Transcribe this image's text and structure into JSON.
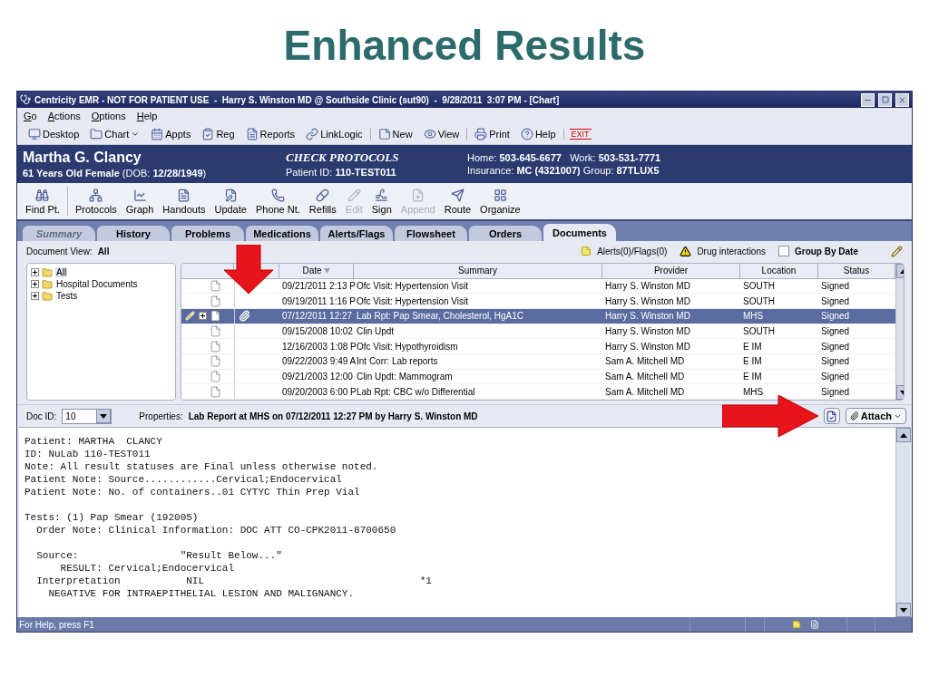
{
  "slide": {
    "title": "Enhanced Results"
  },
  "window": {
    "title": "Centricity EMR - NOT FOR PATIENT USE  -  Harry S. Winston MD @ Southside Clinic (sut90)  -  9/28/2011  3:07 PM - [Chart]"
  },
  "menu": [
    "Go",
    "Actions",
    "Options",
    "Help"
  ],
  "toolbar": [
    [
      {
        "label": "Desktop",
        "dropdown": false
      },
      {
        "label": "Chart",
        "dropdown": true
      },
      {
        "label": "Appts",
        "dropdown": false
      },
      {
        "label": "Reg",
        "dropdown": false
      },
      {
        "label": "Reports",
        "dropdown": false
      },
      {
        "label": "LinkLogic",
        "dropdown": false
      }
    ],
    [
      {
        "label": "New",
        "dropdown": false
      },
      {
        "label": "View",
        "dropdown": false
      }
    ],
    [
      {
        "label": "Print",
        "dropdown": false
      },
      {
        "label": "Help",
        "dropdown": false
      }
    ],
    [
      {
        "label": "EXIT",
        "dropdown": false,
        "kind": "exit"
      }
    ]
  ],
  "patient": {
    "name": "Martha G. Clancy",
    "details": "**61 Years Old Female** (DOB: **12/28/1949**)",
    "alert": "CHECK PROTOCOLS",
    "patient_id": "Patient ID: **110-TEST011**",
    "phones": "Home: **503-645-6677**   Work: **503-531-7771**",
    "insurance": "Insurance: **MC (4321007)** Group: **87TLUX5**"
  },
  "actions": [
    {
      "label": "Find Pt.",
      "disabled": false
    },
    {
      "label": "Protocols",
      "disabled": false
    },
    {
      "label": "Graph",
      "disabled": false
    },
    {
      "label": "Handouts",
      "disabled": false
    },
    {
      "label": "Update",
      "disabled": false
    },
    {
      "label": "Phone Nt.",
      "disabled": false
    },
    {
      "label": "Refills",
      "disabled": false
    },
    {
      "label": "Edit",
      "disabled": true
    },
    {
      "label": "Sign",
      "disabled": false
    },
    {
      "label": "Append",
      "disabled": true
    },
    {
      "label": "Route",
      "disabled": false
    },
    {
      "label": "Organize",
      "disabled": false
    }
  ],
  "tabs": [
    {
      "label": "Summary",
      "selected": false,
      "disabled": true
    },
    {
      "label": "History",
      "selected": false,
      "disabled": false
    },
    {
      "label": "Problems",
      "selected": false,
      "disabled": false
    },
    {
      "label": "Medications",
      "selected": false,
      "disabled": false
    },
    {
      "label": "Alerts/Flags",
      "selected": false,
      "disabled": false
    },
    {
      "label": "Flowsheet",
      "selected": false,
      "disabled": false
    },
    {
      "label": "Orders",
      "selected": false,
      "disabled": false
    },
    {
      "label": "Documents",
      "selected": true,
      "disabled": false
    }
  ],
  "document_view": {
    "label": "Document View:",
    "value": "All",
    "alerts": "Alerts(0)/Flags(0)",
    "drug_interactions": "Drug interactions",
    "group_by_date": {
      "label": "Group By Date",
      "checked": false
    }
  },
  "tree": [
    {
      "label": "All",
      "expanded": false,
      "selected": true
    },
    {
      "label": "Hospital Documents",
      "expanded": false,
      "selected": false
    },
    {
      "label": "Tests",
      "expanded": false,
      "selected": false
    }
  ],
  "table": {
    "columns": [
      "Date",
      "Summary",
      "Provider",
      "Location",
      "Status"
    ],
    "rows": [
      {
        "date": "09/21/2011 2:13 P",
        "summary": "Ofc Visit: Hypertension Visit",
        "provider": "Harry S. Winston MD",
        "location": "SOUTH",
        "status": "Signed",
        "selected": false,
        "edited": false,
        "expandable": false,
        "attachment": false
      },
      {
        "date": "09/19/2011 1:16 P",
        "summary": "Ofc Visit: Hypertension Visit",
        "provider": "Harry S. Winston MD",
        "location": "SOUTH",
        "status": "Signed",
        "selected": false,
        "edited": false,
        "expandable": false,
        "attachment": false
      },
      {
        "date": "07/12/2011 12:27",
        "summary": "Lab Rpt: Pap Smear, Cholesterol, HgA1C",
        "provider": "Harry S. Winston MD",
        "location": "MHS",
        "status": "Signed",
        "selected": true,
        "edited": true,
        "expandable": true,
        "attachment": true
      },
      {
        "date": "09/15/2008 10:02",
        "summary": "Clin Updt",
        "provider": "Harry S. Winston MD",
        "location": "SOUTH",
        "status": "Signed",
        "selected": false,
        "edited": false,
        "expandable": false,
        "attachment": false
      },
      {
        "date": "12/16/2003 1:08 P",
        "summary": "Ofc Visit: Hypothyroidism",
        "provider": "Harry S. Winston MD",
        "location": "E IM",
        "status": "Signed",
        "selected": false,
        "edited": false,
        "expandable": false,
        "attachment": false
      },
      {
        "date": "09/22/2003 9:49 A",
        "summary": "Int Corr: Lab reports",
        "provider": "Sam A. Mitchell MD",
        "location": "E IM",
        "status": "Signed",
        "selected": false,
        "edited": false,
        "expandable": false,
        "attachment": false
      },
      {
        "date": "09/21/2003 12:00",
        "summary": "Clin Updt: Mammogram",
        "provider": "Sam A. Mitchell MD",
        "location": "E IM",
        "status": "Signed",
        "selected": false,
        "edited": false,
        "expandable": false,
        "attachment": false
      },
      {
        "date": "09/20/2003 6:00 P",
        "summary": "Lab Rpt: CBC w/o Differential",
        "provider": "Sam A. Mitchell MD",
        "location": "MHS",
        "status": "Signed",
        "selected": false,
        "edited": false,
        "expandable": false,
        "attachment": false
      }
    ]
  },
  "properties": {
    "doc_id_label": "Doc ID:",
    "doc_id": "10",
    "label": "Properties:",
    "value": "Lab Report at MHS on 07/12/2011 12:27 PM by Harry S. Winston MD",
    "attach": "Attach"
  },
  "report": [
    [
      "Patient: MARTHA  CLANCY",
      "ID: NuLab 110-TEST011",
      "Note: All result statuses are Final unless otherwise noted.",
      "Patient Note: Source............Cervical;Endocervical",
      "Patient Note: No. of containers..01 CYTYC Thin Prep Vial"
    ],
    [
      "Tests: (1) Pap Smear (192005)",
      "  Order Note: Clinical Information: DOC ATT CO-CPK2011-8700650"
    ],
    [
      "  Source:                 \"Result Below...\"",
      "      RESULT: Cervical;Endocervical",
      "  Interpretation           NIL                                    *1",
      "    NEGATIVE FOR INTRAEPITHELIAL LESION AND MALIGNANCY."
    ]
  ],
  "status_bar": {
    "text": "For Help, press F1"
  }
}
